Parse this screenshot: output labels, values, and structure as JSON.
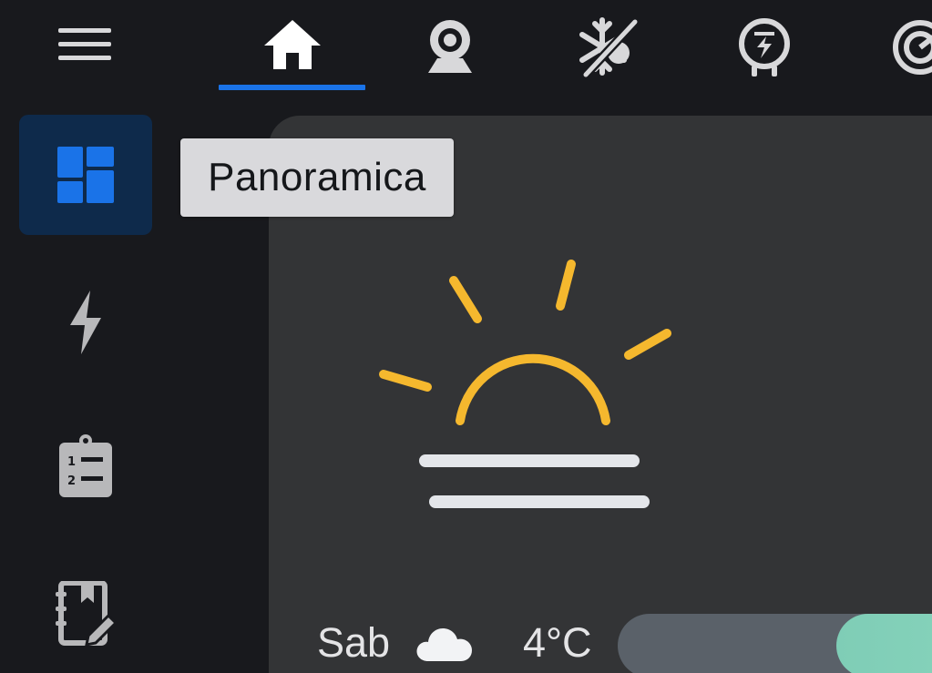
{
  "topbar": {
    "tabs": [
      {
        "icon": "home-icon",
        "active": true
      },
      {
        "icon": "webcam-icon",
        "active": false
      },
      {
        "icon": "climate-off-icon",
        "active": false
      },
      {
        "icon": "energy-meter-icon",
        "active": false
      },
      {
        "icon": "gauge-icon",
        "active": false
      }
    ],
    "accent": "#1a73e8"
  },
  "sidebar": {
    "items": [
      {
        "icon": "dashboard-icon",
        "active": true
      },
      {
        "icon": "lightning-icon",
        "active": false
      },
      {
        "icon": "clipboard-list-icon",
        "active": false
      },
      {
        "icon": "notebook-edit-icon",
        "active": false
      }
    ]
  },
  "tooltip": {
    "text": "Panoramica"
  },
  "weather": {
    "icon": "sunrise-haze-icon",
    "sun_color": "#f5b82e",
    "forecast": {
      "day": "Sab",
      "condition_icon": "cloud-icon",
      "temperature": "4°C",
      "range_fill_fraction": 0.4
    }
  }
}
